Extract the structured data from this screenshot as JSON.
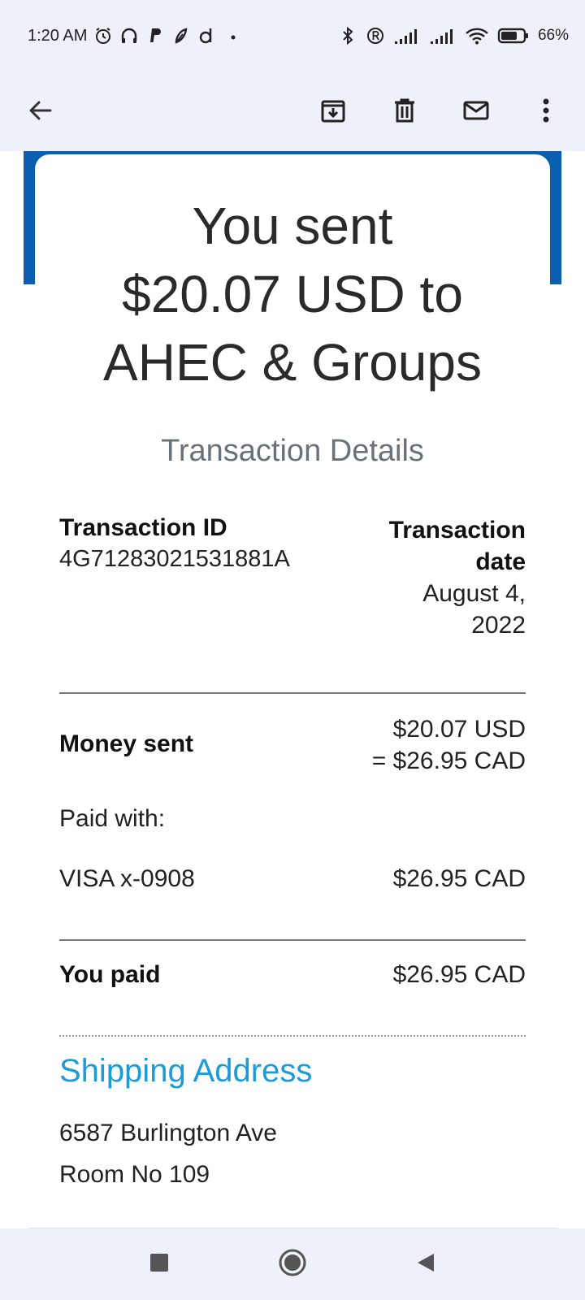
{
  "status_bar": {
    "time": "1:20 AM",
    "battery_percent": "66%",
    "left_icons": [
      "alarm-icon",
      "headset-icon",
      "paypal-icon",
      "pen-icon",
      "d-icon",
      "dot-icon"
    ],
    "right_icons": [
      "bluetooth-icon",
      "registered-icon",
      "signal-icon",
      "signal-icon",
      "wifi-icon",
      "battery-icon"
    ]
  },
  "app_bar": {
    "icons": [
      "back-arrow-icon",
      "archive-icon",
      "delete-icon",
      "mail-icon",
      "more-vert-icon"
    ]
  },
  "email": {
    "headline_line1": "You sent",
    "headline_line2": "$20.07 USD to",
    "headline_line3": "AHEC & Groups",
    "section_title": "Transaction Details",
    "transaction_id_label": "Transaction ID",
    "transaction_id": "4G71283021531881A",
    "transaction_date_label_line1": "Transaction",
    "transaction_date_label_line2": "date",
    "transaction_date_line1": "August 4,",
    "transaction_date_line2": "2022",
    "money_sent_label": "Money sent",
    "money_sent_usd": "$20.07 USD",
    "money_sent_cad": "= $26.95 CAD",
    "paid_with_label": "Paid with:",
    "card_label": "VISA x-0908",
    "card_amount": "$26.95 CAD",
    "you_paid_label": "You paid",
    "you_paid_amount": "$26.95 CAD",
    "shipping_title": "Shipping Address",
    "address_line1": "6587 Burlington Ave",
    "address_line2": "Room No 109"
  },
  "colors": {
    "accent_blue": "#0a5fb0",
    "link_blue": "#1e9ad6",
    "bar_bg": "#eef1f9"
  },
  "nav_bar": {
    "icons": [
      "recents-square-icon",
      "home-circle-icon",
      "back-triangle-icon"
    ]
  }
}
